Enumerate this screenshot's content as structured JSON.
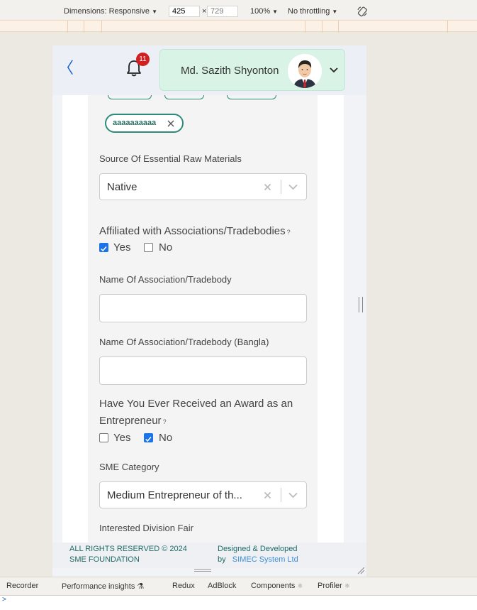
{
  "devtools": {
    "dimensions_label": "Dimensions: Responsive",
    "width": "425",
    "height_placeholder": "729",
    "times": "×",
    "zoom": "100%",
    "throttle": "No throttling",
    "caret": "▼",
    "bottom_tabs": [
      {
        "label": "Recorder"
      },
      {
        "label": "Performance insights"
      },
      {
        "label": "Redux"
      },
      {
        "label": "AdBlock"
      },
      {
        "label": "Components"
      },
      {
        "label": "Profiler"
      }
    ],
    "flask": "⚗",
    "gear": "⚛",
    "prompt": ">"
  },
  "header": {
    "back": "〈",
    "notification_count": "11",
    "user_name": "Md. Sazith Shyonton"
  },
  "form": {
    "chip_label": "aaaaaaaaaa",
    "raw_materials_label": "Source Of Essential Raw Materials",
    "raw_materials_value": "Native",
    "affiliated_label": "Affiliated with Associations/Tradebodies",
    "q_mark": "?",
    "yes": "Yes",
    "no": "No",
    "association_label": "Name Of Association/Tradebody",
    "association_value": "",
    "association_bn_label": "Name Of Association/Tradebody (Bangla)",
    "association_bn_value": "",
    "award_label": "Have You Ever Received an Award as an Entrepreneur",
    "sme_category_label": "SME Category",
    "sme_category_value": "Medium Entrepreneur of th...",
    "division_fair_label": "Interested Division Fair",
    "affiliated_yes_checked": true,
    "award_no_checked": true
  },
  "footer": {
    "rights_line1": "ALL RIGHTS RESERVED © 2024",
    "rights_line2": "SME FOUNDATION",
    "designed_line1": "Designed & Developed",
    "by": "by",
    "company": "SIMEC System Ltd"
  },
  "colors": {
    "accent_teal": "#2e8b7a",
    "checkbox_blue": "#1a73e8",
    "badge_red": "#d21f1f",
    "profile_green": "#d9f4e6"
  }
}
